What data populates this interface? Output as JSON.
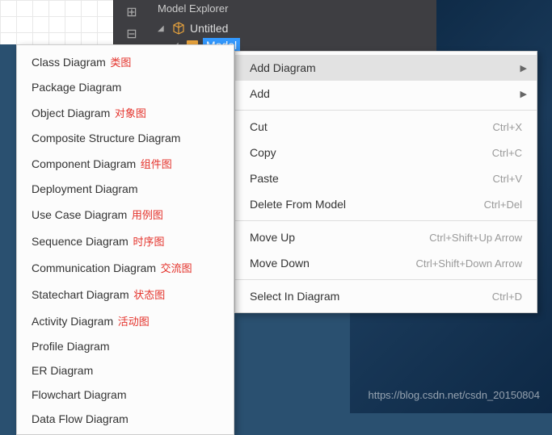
{
  "panel": {
    "title": "Model Explorer",
    "tree": {
      "root": "Untitled",
      "child": "Model"
    }
  },
  "contextMenu": {
    "items": [
      {
        "label": "Add Diagram",
        "shortcut": "",
        "arrow": true,
        "highlighted": true
      },
      {
        "label": "Add",
        "shortcut": "",
        "arrow": true
      },
      {
        "sep": true
      },
      {
        "label": "Cut",
        "shortcut": "Ctrl+X"
      },
      {
        "label": "Copy",
        "shortcut": "Ctrl+C"
      },
      {
        "label": "Paste",
        "shortcut": "Ctrl+V"
      },
      {
        "label": "Delete From Model",
        "shortcut": "Ctrl+Del"
      },
      {
        "sep": true
      },
      {
        "label": "Move Up",
        "shortcut": "Ctrl+Shift+Up Arrow"
      },
      {
        "label": "Move Down",
        "shortcut": "Ctrl+Shift+Down Arrow"
      },
      {
        "sep": true
      },
      {
        "label": "Select In Diagram",
        "shortcut": "Ctrl+D"
      }
    ]
  },
  "submenu": {
    "items": [
      {
        "label": "Class Diagram",
        "ann": "类图"
      },
      {
        "label": "Package Diagram",
        "ann": ""
      },
      {
        "label": "Object Diagram",
        "ann": "对象图"
      },
      {
        "label": "Composite Structure Diagram",
        "ann": ""
      },
      {
        "label": "Component Diagram",
        "ann": "组件图"
      },
      {
        "label": "Deployment Diagram",
        "ann": ""
      },
      {
        "label": "Use Case Diagram",
        "ann": "用例图"
      },
      {
        "label": "Sequence Diagram",
        "ann": "时序图"
      },
      {
        "label": "Communication Diagram",
        "ann": "交流图"
      },
      {
        "label": "Statechart Diagram",
        "ann": "状态图"
      },
      {
        "label": "Activity Diagram",
        "ann": "活动图"
      },
      {
        "label": "Profile Diagram",
        "ann": ""
      },
      {
        "label": "ER Diagram",
        "ann": ""
      },
      {
        "label": "Flowchart Diagram",
        "ann": ""
      },
      {
        "label": "Data Flow Diagram",
        "ann": ""
      }
    ]
  },
  "watermark": "https://blog.csdn.net/csdn_20150804"
}
